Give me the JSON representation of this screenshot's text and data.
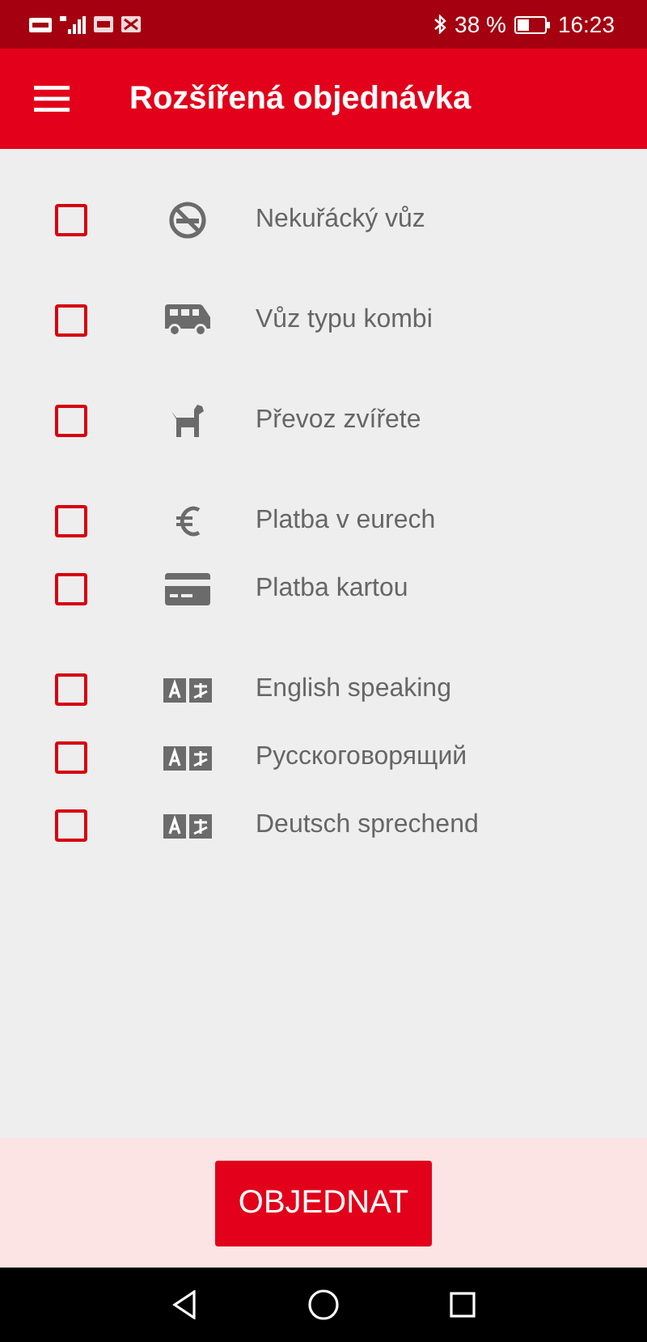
{
  "status_bar": {
    "battery": "38 %",
    "time": "16:23"
  },
  "app_bar": {
    "title": "Rozšířená objednávka"
  },
  "groups": [
    {
      "options": [
        {
          "kind": "no-smoking",
          "label": "Nekuřácký vůz",
          "checked": false
        }
      ]
    },
    {
      "options": [
        {
          "kind": "van",
          "label": "Vůz typu kombi",
          "checked": false
        }
      ]
    },
    {
      "options": [
        {
          "kind": "dog",
          "label": "Převoz zvířete",
          "checked": false
        }
      ]
    },
    {
      "options": [
        {
          "kind": "euro",
          "label": "Platba v eurech",
          "checked": false
        },
        {
          "kind": "card",
          "label": "Platba kartou",
          "checked": false
        }
      ]
    },
    {
      "options": [
        {
          "kind": "language",
          "label": "English speaking",
          "checked": false
        },
        {
          "kind": "language",
          "label": "Русскоговорящий",
          "checked": false
        },
        {
          "kind": "language",
          "label": "Deutsch sprechend",
          "checked": false
        }
      ]
    }
  ],
  "order_button": "OBJEDNAT"
}
